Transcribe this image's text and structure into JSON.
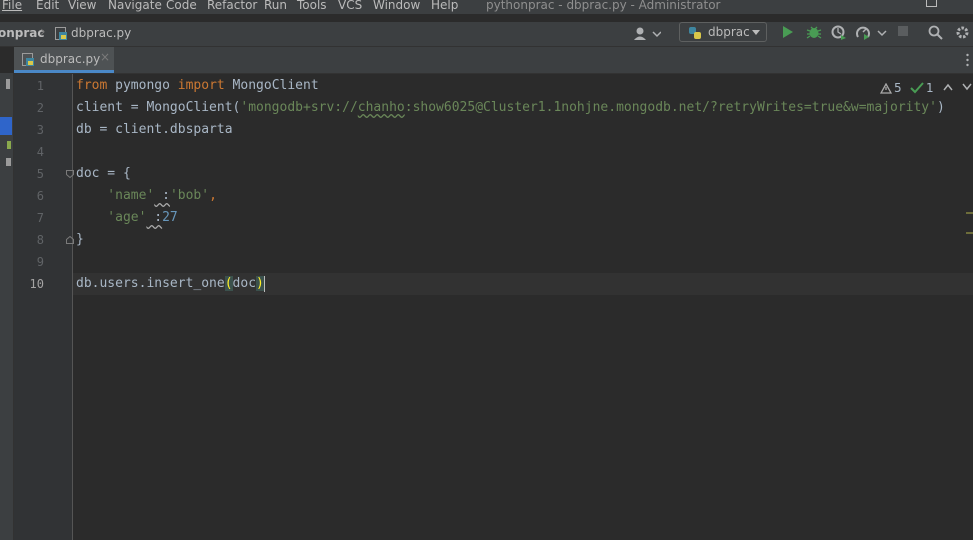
{
  "menubar": {
    "items": [
      {
        "label": "File"
      },
      {
        "label": "Edit"
      },
      {
        "label": "View"
      },
      {
        "label": "Navigate"
      },
      {
        "label": "Code"
      },
      {
        "label": "Refactor"
      },
      {
        "label": "Run"
      },
      {
        "label": "Tools"
      },
      {
        "label": "VCS"
      },
      {
        "label": "Window"
      },
      {
        "label": "Help"
      }
    ],
    "window_title": "pythonprac - dbprac.py - Administrator"
  },
  "navbar": {
    "project": "onprac",
    "file": "dbprac.py",
    "run_config": "dbprac"
  },
  "tabs": [
    {
      "label": "dbprac.py",
      "close": "×"
    }
  ],
  "inspections": {
    "warnings": "5",
    "ok": "1"
  },
  "editor": {
    "line_numbers": [
      "1",
      "2",
      "3",
      "4",
      "5",
      "6",
      "7",
      "8",
      "9",
      "10"
    ],
    "current_line": "10",
    "code": {
      "l1_from": "from",
      "l1_mod": " pymongo ",
      "l1_import": "import",
      "l1_name": " MongoClient",
      "l2_a": "client = MongoClient(",
      "l2_str_a": "'mongodb+srv://",
      "l2_typo": "chanho",
      "l2_str_b": ":show6025@Cluster1.1nohjne.mongodb.net/?retryWrites=true&w=majority'",
      "l2_b": ")",
      "l3": "db = client.dbsparta",
      "l5": "doc = {",
      "l6_key": "    'name'",
      "l6_colon": " :",
      "l6_val": "'bob'",
      "l6_comma": ",",
      "l7_key": "    'age'",
      "l7_colon": " :",
      "l7_val": "27",
      "l8": "}",
      "l10_a": "db.users.insert_one",
      "l10_po": "(",
      "l10_arg": "doc",
      "l10_pc": ")"
    }
  },
  "colors": {
    "keyword": "#cc7832",
    "string": "#6a8759",
    "number": "#6897bb",
    "text": "#a9b7c6",
    "background": "#2b2b2b"
  }
}
